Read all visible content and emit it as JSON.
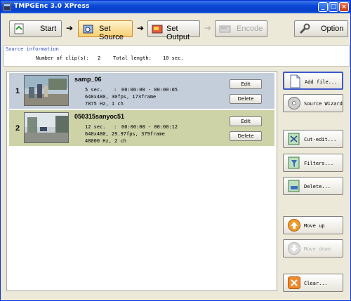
{
  "window": {
    "title": "TMPGEnc 3.0 XPress"
  },
  "steps": {
    "start": "Start",
    "set_source": "Set Source",
    "set_output": "Set Output",
    "encode": "Encode",
    "option": "Option"
  },
  "source_info": {
    "title": "Source information",
    "clips_label": "Number of clip(s):",
    "clips_value": "2",
    "length_label": "Total length:",
    "length_value": "10 sec."
  },
  "clips": [
    {
      "index": "1",
      "name": "samp_06",
      "duration": "5 sec.",
      "range": "00:00:00 - 00:00:05",
      "video": "640x480,  30fps,  173frame",
      "audio": "7875 Hz,  1 ch",
      "edit_label": "Edit",
      "delete_label": "Delete"
    },
    {
      "index": "2",
      "name": "050315sanyoc51",
      "duration": "12 sec.",
      "range": "00:00:00 - 00:00:12",
      "video": "640x480,  29.97fps,  379frame",
      "audio": "48000 Hz,  2 ch",
      "edit_label": "Edit",
      "delete_label": "Delete"
    }
  ],
  "side_buttons": {
    "add_file": "Add file...",
    "source_wizard": "Source Wizard",
    "cut_edit": "Cut-edit...",
    "filters": "Filters...",
    "delete": "Delete...",
    "move_up": "Move up",
    "move_down": "Move down",
    "clear": "Clear..."
  },
  "colors": {
    "title_bar": "#0a46d8",
    "active_step": "#f6cf74",
    "clip1_bg": "#c4cedb",
    "clip2_bg": "#cdd2a7",
    "info_title": "#2a48c2"
  }
}
